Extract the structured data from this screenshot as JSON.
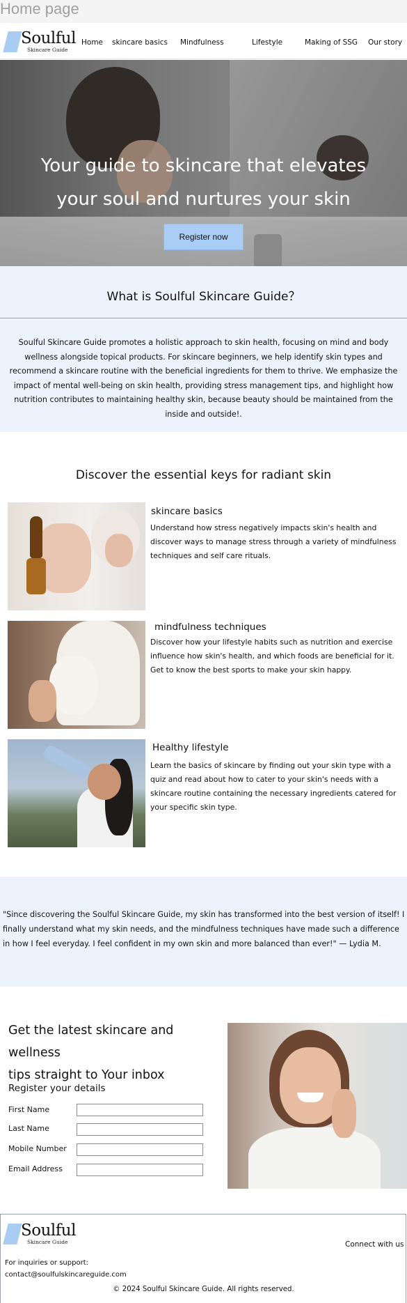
{
  "page_label": "Home page",
  "brand": {
    "name": "Soulful",
    "tagline": "Skincare Guide",
    "logo_color": "#a9cdf2"
  },
  "nav": [
    {
      "label": "Home"
    },
    {
      "label": "skincare basics"
    },
    {
      "label": "Mindfulness"
    },
    {
      "label": "Lifestyle"
    },
    {
      "label": "Making of SSG"
    },
    {
      "label": "Our story"
    }
  ],
  "hero": {
    "line1": "Your guide to skincare that elevates",
    "line2": "your soul and nurtures your skin",
    "cta": "Register now",
    "cta_color": "#a9cdf5"
  },
  "about": {
    "title": "What is Soulful Skincare Guide？",
    "body": "Soulful Skincare Guide promotes a holistic approach to skin health, focusing on mind and body wellness alongside topical products. For skincare beginners, we help identify skin types and recommend a skincare routine with the beneficial ingredients for them to thrive. We emphasize the impact of mental well-being on skin health, providing stress management tips, and highlight how nutrition contributes to maintaining healthy skin, because beauty should be maintained from the inside and outside!."
  },
  "keys": {
    "title": "Discover the essential keys for radiant skin",
    "items": [
      {
        "title": "skincare basics",
        "text": "Understand how stress negatively impacts skin's health and discover ways to manage stress through a variety of mindfulness techniques and self care rituals."
      },
      {
        "title": "mindfulness techniques",
        "text": "Discover how your lifestyle habits such as nutrition and exercise influence how skin's health, and which foods are beneficial for it. Get to know the best sports to make your skin happy."
      },
      {
        "title": "Healthy lifestyle",
        "text": "Learn the basics of skincare by finding out your skin type with a quiz and read about how to cater to your skin's needs with a skincare routine  containing the necessary ingredients catered for your specific skin type."
      }
    ]
  },
  "testimonial": {
    "text": "\"Since discovering the Soulful Skincare Guide, my skin has transformed into the best version of itself! I finally understand what my skin needs, and the mindfulness techniques have made such a difference in how I feel everyday. I feel confident in my own skin and more balanced than ever!\" — Lydia M."
  },
  "newsletter": {
    "title_line1": "Get the latest skincare and wellness",
    "title_line2": "tips straight to Your inbox",
    "register_title": "Register your details",
    "fields": [
      {
        "label": "First Name",
        "value": ""
      },
      {
        "label": "Last Name",
        "value": ""
      },
      {
        "label": "Mobile Number",
        "value": ""
      },
      {
        "label": "Email Address",
        "value": ""
      }
    ]
  },
  "footer": {
    "connect": "Connect with us",
    "inquiries_label": "For inquiries or support:",
    "email": "contact@soulfulskincareguide.com",
    "copyright": "© 2024 Soulful Skincare Guide. All rights reserved."
  },
  "accent_background": "#edf3fd"
}
